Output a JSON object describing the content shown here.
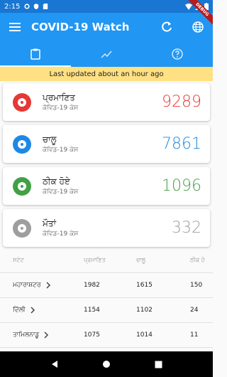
{
  "status_bar": {
    "time": "2:15"
  },
  "debug_banner": "DEBUG",
  "app_bar": {
    "title": "COVID-19 Watch"
  },
  "update_banner": "Last updated about an hour ago",
  "cards": [
    {
      "label": "ਪ੍ਰਮਾਣਿਤ",
      "sub": "ਕੋਵਿਡ-19 ਕੇਸ",
      "value": "9289",
      "color": "#e53935"
    },
    {
      "label": "ਚਾਲੂ",
      "sub": "ਕੋਵਿਡ-19 ਕੇਸ",
      "value": "7861",
      "color": "#1e88e5"
    },
    {
      "label": "ਠੀਕ ਹੋਏ",
      "sub": "ਕੋਵਿਡ-19 ਕੇਸ",
      "value": "1096",
      "color": "#43a047"
    },
    {
      "label": "ਮੌਤਾਂ",
      "sub": "ਕੋਵਿਡ-19 ਕੇਸ",
      "value": "332",
      "color": "#9e9e9e"
    }
  ],
  "table": {
    "headers": [
      "ਸਟੇਟ",
      "ਪ੍ਰਮਾਣਿਤ",
      "ਚਾਲੂ",
      "ਠੀਕ ਹੋ"
    ],
    "rows": [
      [
        "ਮਹਾਰਾਸ਼ਟਰ",
        "1982",
        "1615",
        "150"
      ],
      [
        "ਦਿੱਲੀ",
        "1154",
        "1102",
        "24"
      ],
      [
        "ਤਾਮਿਲਨਾਡੂ",
        "1075",
        "1014",
        "11"
      ]
    ]
  }
}
